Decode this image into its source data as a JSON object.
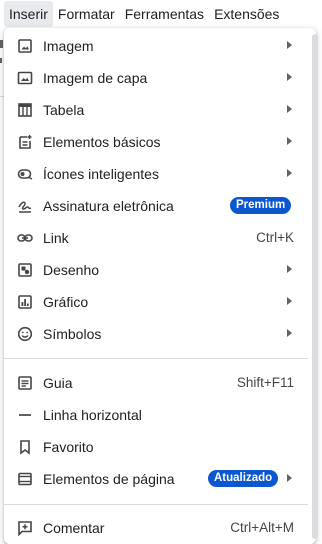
{
  "menubar": {
    "insert": "Inserir",
    "format": "Formatar",
    "tools": "Ferramentas",
    "extensions": "Extensões"
  },
  "menu": {
    "image": "Imagem",
    "cover_image": "Imagem de capa",
    "table": "Tabela",
    "building_blocks": "Elementos básicos",
    "smart_chips": "Ícones inteligentes",
    "esignature": "Assinatura eletrônica",
    "esignature_badge": "Premium",
    "link": "Link",
    "link_shortcut": "Ctrl+K",
    "drawing": "Desenho",
    "chart": "Gráfico",
    "symbols": "Símbolos",
    "tab": "Guia",
    "tab_shortcut": "Shift+F11",
    "horizontal_line": "Linha horizontal",
    "bookmark": "Favorito",
    "page_elements": "Elementos de página",
    "page_elements_badge": "Atualizado",
    "comment": "Comentar",
    "comment_shortcut": "Ctrl+Alt+M"
  },
  "colors": {
    "badge": "#0b57d0",
    "icon": "#444746",
    "separator": "#dadce0"
  }
}
